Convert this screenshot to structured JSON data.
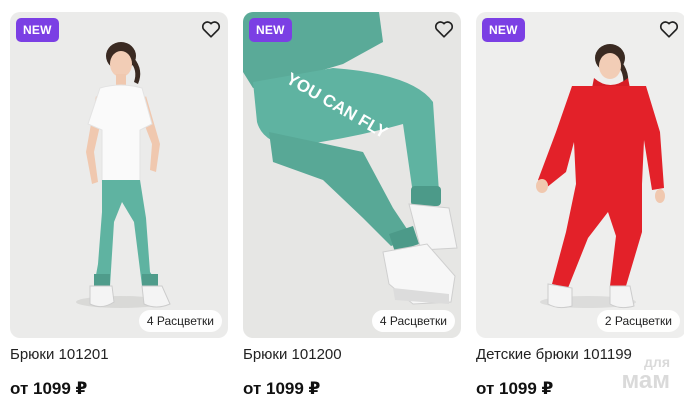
{
  "products": [
    {
      "badge": "NEW",
      "name": "Брюки 101201",
      "price": "от 1099 ₽",
      "colors_count": "4 Расцветки",
      "image_icon": "girl-white-tshirt-mint-pants-photo",
      "pants_color": "#5fb3a1"
    },
    {
      "badge": "NEW",
      "name": "Брюки 101200",
      "price": "от 1099 ₽",
      "colors_count": "4 Расцветки",
      "image_icon": "mint-pants-you-can-fly-closeup-photo",
      "pants_color": "#5aaa98",
      "print_text": "YOU CAN FLY"
    },
    {
      "badge": "NEW",
      "name": "Детские брюки 101199",
      "price": "от 1099 ₽",
      "colors_count": "2 Расцветки",
      "image_icon": "girl-red-hoodie-red-pants-photo",
      "pants_color": "#e32129"
    }
  ],
  "favorite_icon": "heart-outline-icon",
  "badge_color": "#7b3fe4",
  "watermark": {
    "line1": "для",
    "line2": "мам"
  }
}
